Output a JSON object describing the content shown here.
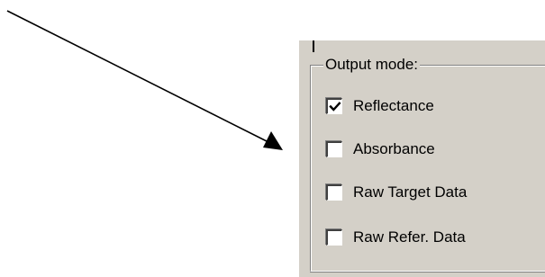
{
  "group": {
    "title": "Output mode:"
  },
  "options": [
    {
      "label": "Reflectance",
      "checked": true
    },
    {
      "label": "Absorbance",
      "checked": false
    },
    {
      "label": "Raw Target Data",
      "checked": false
    },
    {
      "label": "Raw Refer. Data",
      "checked": false
    }
  ],
  "colors": {
    "panel_background": "#d4d0c8",
    "checkbox_background": "#ffffff",
    "text": "#000000"
  }
}
